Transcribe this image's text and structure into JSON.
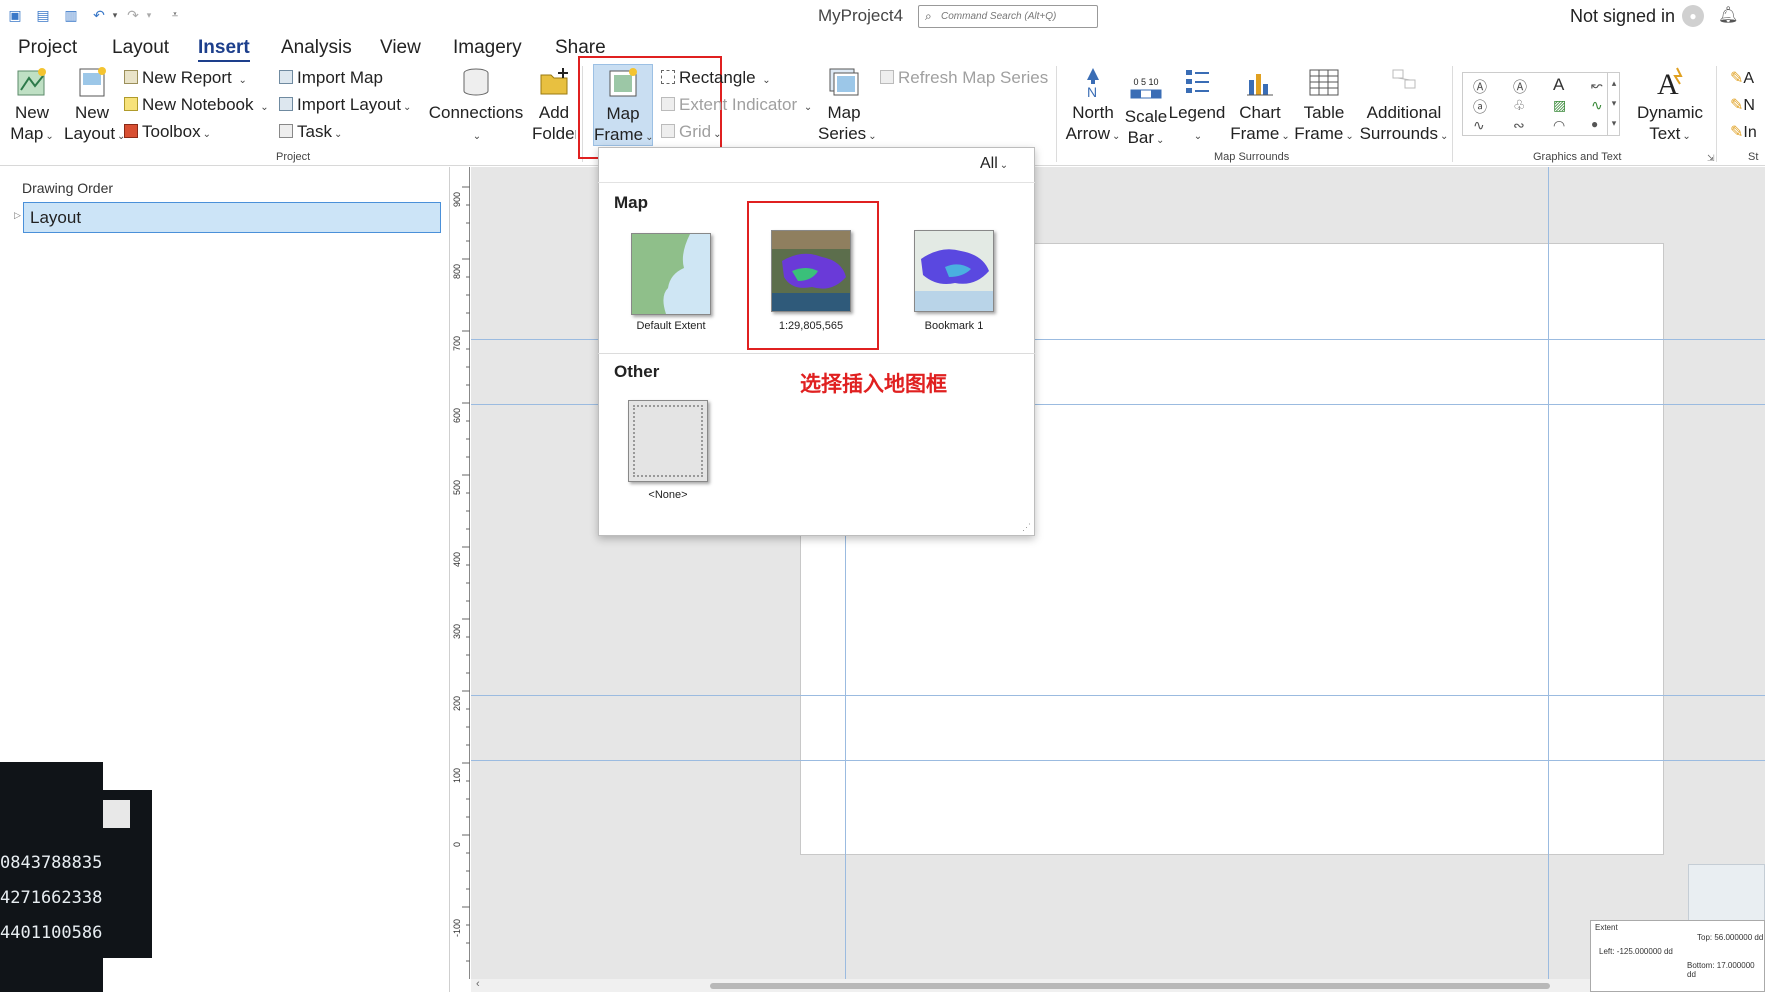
{
  "window": {
    "title": "MyProject4",
    "search_placeholder": "Command Search (Alt+Q)",
    "signin": "Not signed in"
  },
  "tabs": [
    "Project",
    "Layout",
    "Insert",
    "Analysis",
    "View",
    "Imagery",
    "Share"
  ],
  "active_tab": "Insert",
  "ribbon": {
    "project_group": {
      "label": "Project",
      "new_map": [
        "New",
        "Map"
      ],
      "new_layout": [
        "New",
        "Layout"
      ],
      "new_report": "New Report",
      "new_notebook": "New Notebook",
      "toolbox": "Toolbox",
      "import_map": "Import Map",
      "import_layout": "Import Layout",
      "task": "Task",
      "connections": "Connections",
      "add_folder": [
        "Add",
        "Folder"
      ]
    },
    "map_frames": {
      "map_frame": [
        "Map",
        "Frame"
      ],
      "rectangle": "Rectangle",
      "extent_indicator": "Extent Indicator",
      "grid": "Grid",
      "map_series": [
        "Map",
        "Series"
      ],
      "refresh_map_series": "Refresh Map Series"
    },
    "map_surrounds": {
      "label": "Map Surrounds",
      "north_arrow": [
        "North",
        "Arrow"
      ],
      "scale_bar": [
        "Scale",
        "Bar"
      ],
      "scale_bar_ticks": "0 5 10",
      "legend": "Legend",
      "chart_frame": [
        "Chart",
        "Frame"
      ],
      "table_frame": [
        "Table",
        "Frame"
      ],
      "additional_surrounds": [
        "Additional",
        "Surrounds"
      ]
    },
    "graphics_text": {
      "label": "Graphics and Text",
      "dynamic_text": [
        "Dynamic",
        "Text"
      ]
    },
    "partial_group_label": "St",
    "partial_items": [
      "A",
      "N",
      "In"
    ]
  },
  "left_pane": {
    "header": "Drawing Order",
    "item": "Layout"
  },
  "terminal": {
    "lines": [
      "0843788835",
      "4271662338",
      "4401100586"
    ]
  },
  "ruler": {
    "ticks": [
      "900",
      "800",
      "700",
      "600",
      "500",
      "400",
      "300",
      "200",
      "100",
      "0",
      "-100"
    ]
  },
  "gallery": {
    "filter": "All",
    "section_map": "Map",
    "section_other": "Other",
    "items": [
      {
        "label": "Default Extent"
      },
      {
        "label": "1:29,805,565"
      },
      {
        "label": "Bookmark 1"
      }
    ],
    "none_label": "<None>",
    "annotation": "选择插入地图框"
  },
  "extent_widget": {
    "title": "Extent",
    "top": "Top: 56.000000 dd",
    "left": "Left: -125.000000 dd",
    "bottom": "Bottom: 17.000000 dd"
  },
  "colors": {
    "accent": "#1d3f8c",
    "selection": "#cce4f7",
    "annotation": "#e02020",
    "guide": "#9bbbe0"
  }
}
